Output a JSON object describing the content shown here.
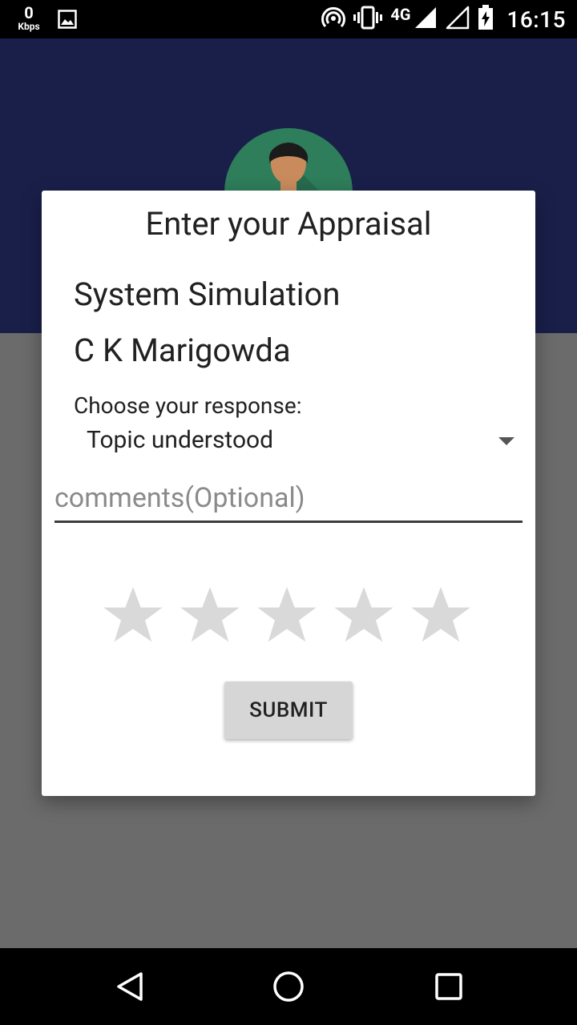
{
  "status_bar": {
    "speed_value": "0",
    "speed_unit": "Kbps",
    "network": "4G",
    "time": "16:15",
    "icons": [
      "image-icon",
      "hotspot-icon",
      "vibrate-icon",
      "signal-icon",
      "signal-empty-icon",
      "battery-charging-icon"
    ]
  },
  "dialog": {
    "title": "Enter your Appraisal",
    "subject": "System Simulation",
    "teacher": "C K Marigowda",
    "response_prompt": "Choose your response:",
    "response_selected": "Topic understood",
    "comments_placeholder": "comments(Optional)",
    "comments_value": "",
    "rating": {
      "value": 0,
      "max": 5
    },
    "submit_label": "SUBMIT"
  },
  "nav_bar": {
    "icons": [
      "back-icon",
      "home-icon",
      "recents-icon"
    ]
  },
  "colors": {
    "app_bar": "#1a1f4a",
    "avatar_bg": "#2e7d5b",
    "scrim": "#6b6b6b",
    "star_empty": "#d9d9d9",
    "button_bg": "#d6d6d6"
  }
}
